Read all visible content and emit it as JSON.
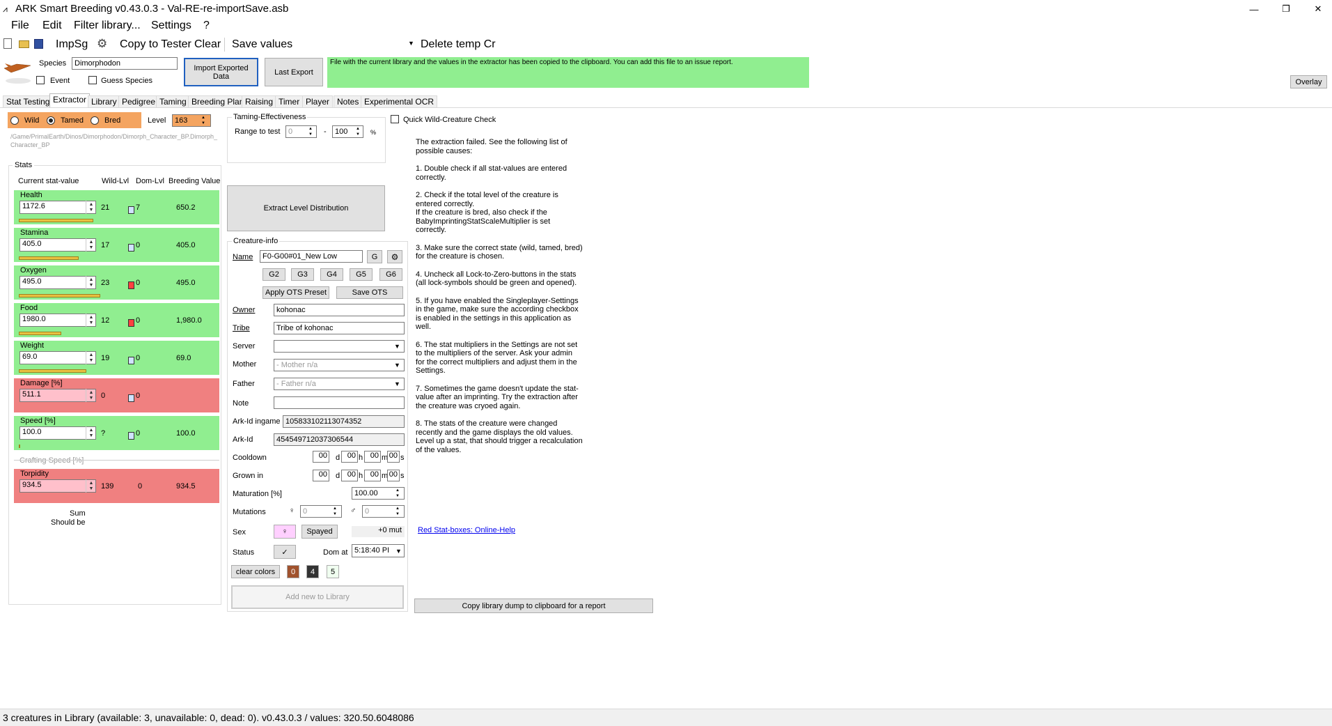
{
  "window": {
    "title": "ARK Smart Breeding v0.43.0.3 - Val-RE-re-importSave.asb"
  },
  "menu": [
    "File",
    "Edit",
    "Filter library...",
    "Settings",
    "?"
  ],
  "toolbar": {
    "impsg": "ImpSg",
    "copy_to_tester": "Copy to Tester",
    "clear": "Clear",
    "save_values": "Save values",
    "delete_temp": "Delete temp Cr"
  },
  "header": {
    "species_label": "Species",
    "species_value": "Dimorphodon",
    "event_label": "Event",
    "guess_species_label": "Guess Species",
    "import_exported": "Import Exported Data",
    "last_export": "Last Export",
    "message": "File with the current library and the values in the extractor has been copied to the clipboard. You can add this file to an issue report.",
    "overlay": "Overlay"
  },
  "tabs": [
    "Stat Testing",
    "Extractor",
    "Library",
    "Pedigree",
    "Taming",
    "Breeding Plan",
    "Raising",
    "Timer",
    "Player",
    "Notes",
    "Experimental OCR"
  ],
  "state": {
    "wild": "Wild",
    "tamed": "Tamed",
    "bred": "Bred",
    "selected": "Tamed",
    "level_label": "Level",
    "level_value": "163",
    "blueprint": "/Game/PrimalEarth/Dinos/Dimorphodon/Dimorph_Character_BP.Dimorph_Character_BP"
  },
  "taming": {
    "title": "Taming-Effectiveness",
    "range_label": "Range to test",
    "min": "0",
    "max": "100",
    "dash": "-",
    "pct": "%"
  },
  "quick_check": "Quick Wild-Creature Check",
  "stats": {
    "group": "Stats",
    "col_current": "Current stat-value",
    "col_wild": "Wild-Lvl",
    "col_dom": "Dom-Lvl",
    "col_breeding": "Breeding Value",
    "rows": [
      {
        "name": "Health",
        "value": "1172.6",
        "wild": "21",
        "dom": "7",
        "bv": "650.2",
        "status": "ok",
        "lock": "open",
        "bar": 0.79
      },
      {
        "name": "Stamina",
        "value": "405.0",
        "wild": "17",
        "dom": "0",
        "bv": "405.0",
        "status": "ok",
        "lock": "open",
        "bar": 0.64
      },
      {
        "name": "Oxygen",
        "value": "495.0",
        "wild": "23",
        "dom": "0",
        "bv": "495.0",
        "status": "ok",
        "lock": "closed",
        "bar": 0.87
      },
      {
        "name": "Food",
        "value": "1980.0",
        "wild": "12",
        "dom": "0",
        "bv": "1,980.0",
        "status": "ok",
        "lock": "closed",
        "bar": 0.45
      },
      {
        "name": "Weight",
        "value": "69.0",
        "wild": "19",
        "dom": "0",
        "bv": "69.0",
        "status": "ok",
        "lock": "open",
        "bar": 0.72
      },
      {
        "name": "Damage [%]",
        "value": "511.1",
        "wild": "0",
        "dom": "0",
        "bv": "",
        "status": "error",
        "lock": "open",
        "bar": 0
      },
      {
        "name": "Speed [%]",
        "value": "100.0",
        "wild": "?",
        "dom": "0",
        "bv": "100.0",
        "status": "ok",
        "lock": "open",
        "bar": 0.01
      }
    ],
    "crafting": "Crafting Speed [%]",
    "torpidity": {
      "name": "Torpidity",
      "value": "934.5",
      "wild": "139",
      "dom": "0",
      "bv": "934.5"
    },
    "sum": "Sum",
    "should_be": "Should be"
  },
  "extract_button": "Extract Level Distribution",
  "creature_info": {
    "title": "Creature-info",
    "name_label": "Name",
    "name_value": "F0-G00#01_New Low",
    "g_button": "G",
    "gen_buttons": [
      "G2",
      "G3",
      "G4",
      "G5",
      "G6"
    ],
    "apply_ots": "Apply OTS Preset",
    "save_ots": "Save OTS",
    "owner_label": "Owner",
    "owner_value": "kohonac",
    "tribe_label": "Tribe",
    "tribe_value": "Tribe of kohonac",
    "server_label": "Server",
    "server_value": "",
    "mother_label": "Mother",
    "mother_value": "- Mother n/a",
    "father_label": "Father",
    "father_value": "- Father n/a",
    "note_label": "Note",
    "arkid_ingame_label": "Ark-Id ingame",
    "arkid_ingame_value": "105833102113074352",
    "arkid_label": "Ark-Id",
    "arkid_value": "454549712037306544",
    "cooldown_label": "Cooldown",
    "grownin_label": "Grown in",
    "time_fields": [
      "00",
      "00",
      "00",
      "00"
    ],
    "time_units": [
      "d",
      "h",
      "m",
      "s"
    ],
    "maturation_label": "Maturation [%]",
    "maturation_value": "100.00",
    "mutations_label": "Mutations",
    "mut_f": "0",
    "mut_m": "0",
    "sex_label": "Sex",
    "sex_symbol": "♀",
    "spayed": "Spayed",
    "mut_count": "+0 mut",
    "status_label": "Status",
    "status_symbol": "✓",
    "dom_at_label": "Dom at",
    "dom_at_value": "5:18:40 PI",
    "clear_colors": "clear colors",
    "colors": [
      "0",
      "4",
      "5"
    ],
    "add_new": "Add new to Library"
  },
  "explanation": [
    "The extraction failed. See the following list of possible causes:",
    "1. Double check if all stat-values are entered correctly.",
    "2. Check if the total level of the creature is entered correctly.\nIf the creature is bred, also check if the BabyImprintingStatScaleMultiplier is set correctly.",
    "3. Make sure the correct state (wild, tamed, bred) for the creature is chosen.",
    "4. Uncheck all Lock-to-Zero-buttons in the stats (all lock-symbols should be green and opened).",
    "5. If you have enabled the Singleplayer-Settings in the game, make sure the according checkbox is enabled in the settings in this application as well.",
    "6. The stat multipliers in the Settings are not set to the multipliers of the server. Ask your admin for the correct multipliers and adjust them in the Settings.",
    "7. Sometimes the game doesn't update the stat-value after an imprinting. Try the extraction after the creature was cryoed again.",
    "8. The stats of the creature were changed recently and the game displays the old values. Level up a stat, that should trigger a recalculation of the values."
  ],
  "help_link": "Red Stat-boxes: Online-Help",
  "copy_dump": "Copy library dump to clipboard for a report",
  "statusbar": "3 creatures in Library (available: 3, unavailable: 0, dead: 0). v0.43.0.3 / values: 320.50.6048086",
  "colors": {
    "ok": "#90ee90",
    "error": "#f08080",
    "message_bg": "#90ee90",
    "level_bg": "#f4a460"
  }
}
